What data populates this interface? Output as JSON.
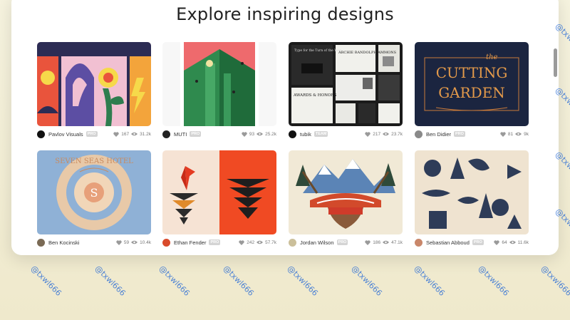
{
  "page": {
    "title": "Explore inspiring designs"
  },
  "watermark": "@txwl666",
  "shots": [
    {
      "author": "Pavlov Visuals",
      "badge": "PRO",
      "likes": "167",
      "views": "31.2k",
      "avatar_color": "#111111"
    },
    {
      "author": "MUTI",
      "badge": "PRO",
      "likes": "93",
      "views": "25.2k",
      "avatar_color": "#222222"
    },
    {
      "author": "tubik",
      "badge": "TEAM",
      "likes": "217",
      "views": "23.7k",
      "avatar_color": "#111111"
    },
    {
      "author": "Ben Didier",
      "badge": "PRO",
      "likes": "81",
      "views": "9k",
      "avatar_color": "#8a8a8a"
    },
    {
      "author": "Ben Kocinski",
      "badge": "",
      "likes": "59",
      "views": "10.4k",
      "avatar_color": "#7a6a55"
    },
    {
      "author": "Ethan Fender",
      "badge": "PRO",
      "likes": "242",
      "views": "57.7k",
      "avatar_color": "#d94b2b"
    },
    {
      "author": "Jordan Wilson",
      "badge": "PRO",
      "likes": "186",
      "views": "47.1k",
      "avatar_color": "#cbbf9a"
    },
    {
      "author": "Sebastian Abboud",
      "badge": "PRO",
      "likes": "64",
      "views": "11.6k",
      "avatar_color": "#c9876a"
    }
  ],
  "artwork_text": {
    "cutting_garden": [
      "the",
      "CUTTING",
      "GARDEN"
    ],
    "tubik_heading": "Type for the Turn of the Year",
    "tubik_name": "ARCHIE RANDOLPH AMMONS",
    "tubik_awards": "AWARDS & HONORS",
    "hotel_ring": "SEVEN SEAS HOTEL",
    "hotel_monogram": "S"
  },
  "icons": {
    "like": "heart-icon",
    "views": "eye-icon"
  }
}
